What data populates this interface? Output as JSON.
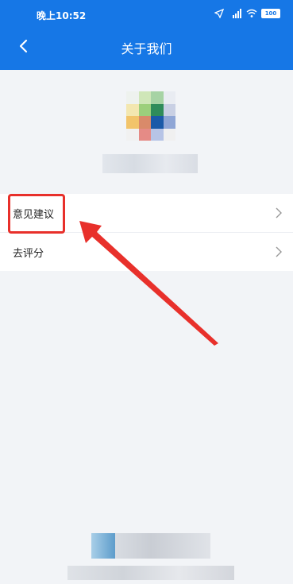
{
  "status_bar": {
    "time": "晚上10:52",
    "battery": "100"
  },
  "header": {
    "title": "关于我们"
  },
  "menu": {
    "items": [
      {
        "label": "意见建议"
      },
      {
        "label": "去评分"
      }
    ]
  },
  "colors": {
    "header_bg": "#1677e6",
    "page_bg": "#f2f4f7",
    "highlight": "#e8302b"
  }
}
